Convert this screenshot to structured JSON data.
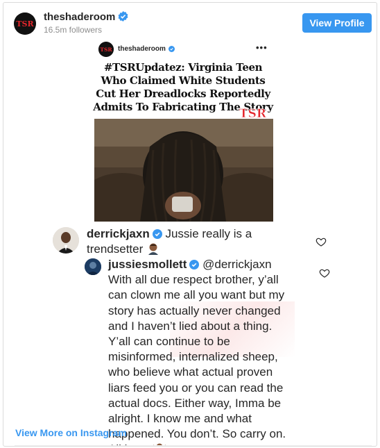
{
  "header": {
    "username": "theshaderoom",
    "followers": "16.5m followers",
    "view_profile_label": "View Profile"
  },
  "post": {
    "inner_username": "theshaderoom",
    "more_label": "•••",
    "headline": "#TSRUpdatez: Virginia Teen Who Claimed White Students Cut Her Dreadlocks Reportedly Admits To Fabricating The Story",
    "logo_text": "TSR"
  },
  "comments": [
    {
      "username": "derrickjaxn",
      "text": "Jussie really is a trendsetter"
    },
    {
      "username": "jussiesmollett",
      "mention": "@derrickjaxn",
      "text": "With all due respect brother, y’all can clown me all you want but my story has actually never changed and I haven’t lied about a thing. Y’all can continue to be misinformed, internalized sheep, who believe what actual proven liars feed you or you can read the actual docs. Either way, Imma be alright. I know me and what happened. You don’t. So carry on. All love."
    }
  ],
  "footer": {
    "view_more_label": "View More on Instagram"
  },
  "colors": {
    "accent": "#3897f0",
    "text": "#262626",
    "muted": "#8e8e8e",
    "tsr_red": "#e4262c"
  }
}
